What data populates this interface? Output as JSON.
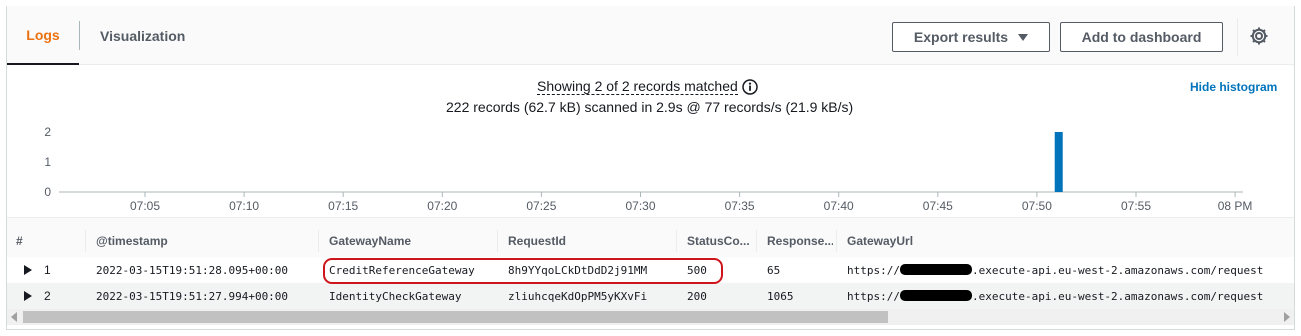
{
  "tabs": {
    "logs": "Logs",
    "visualization": "Visualization"
  },
  "toolbar": {
    "export_label": "Export results",
    "add_dashboard_label": "Add to dashboard"
  },
  "histogram": {
    "title": "Showing 2 of 2 records matched",
    "stats": "222 records (62.7 kB) scanned in 2.9s @ 77 records/s (21.9 kB/s)",
    "hide_label": "Hide histogram"
  },
  "chart_data": {
    "type": "bar",
    "x_ticks": [
      "07:05",
      "07:10",
      "07:15",
      "07:20",
      "07:25",
      "07:30",
      "07:35",
      "07:40",
      "07:45",
      "07:50",
      "07:55",
      "08 PM"
    ],
    "y_ticks": [
      "0",
      "1",
      "2"
    ],
    "ylim": [
      0,
      2
    ],
    "series": [
      {
        "time": "07:51",
        "value": 2
      }
    ],
    "bar_color": "#0073bb"
  },
  "table": {
    "headers": {
      "num": "#",
      "timestamp": "@timestamp",
      "gateway_name": "GatewayName",
      "request_id": "RequestId",
      "status_code": "StatusCo...",
      "response": "Response...",
      "gateway_url": "GatewayUrl"
    },
    "rows": [
      {
        "num": "1",
        "timestamp": "2022-03-15T19:51:28.095+00:00",
        "gateway_name": "CreditReferenceGateway",
        "request_id": "8h9YYqoLCkDtDdD2j91MM",
        "status_code": "500",
        "response": "65",
        "url_prefix": "https://",
        "url_suffix": ".execute-api.eu-west-2.amazonaws.com/request"
      },
      {
        "num": "2",
        "timestamp": "2022-03-15T19:51:27.994+00:00",
        "gateway_name": "IdentityCheckGateway",
        "request_id": "zliuhcqeKdOpPM5yKXvFi",
        "status_code": "200",
        "response": "1065",
        "url_prefix": "https://",
        "url_suffix": ".execute-api.eu-west-2.amazonaws.com/request"
      }
    ]
  },
  "colors": {
    "accent": "#ec7211",
    "link": "#0073bb",
    "highlight": "#d0141c"
  }
}
